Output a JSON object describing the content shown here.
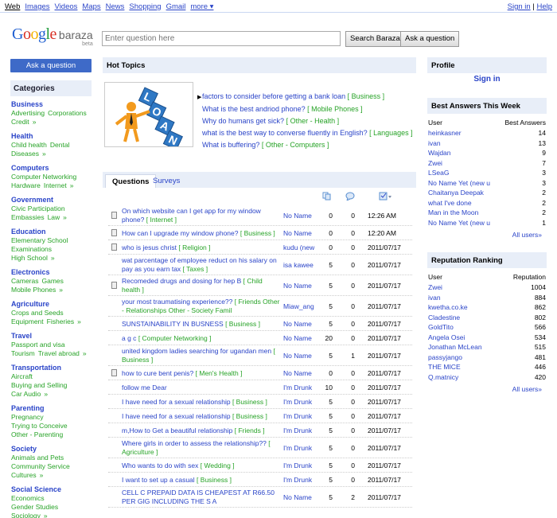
{
  "topnav": [
    "Web",
    "Images",
    "Videos",
    "Maps",
    "News",
    "Shopping",
    "Gmail",
    "more ▾"
  ],
  "topright": {
    "signin": "Sign in",
    "sep": " | ",
    "help": "Help"
  },
  "logo": {
    "google": "Google",
    "baraza": "baraza",
    "beta": "beta"
  },
  "search": {
    "placeholder": "Enter question here",
    "search_btn": "Search Baraza",
    "ask_btn": "Ask a question"
  },
  "sidebar": {
    "ask_label": "Ask a question",
    "categories_title": "Categories",
    "categories": [
      {
        "title": "Business",
        "lines": [
          [
            "Advertising",
            "Corporations"
          ],
          [
            "Credit",
            "»"
          ]
        ]
      },
      {
        "title": "Health",
        "lines": [
          [
            "Child health",
            "Dental"
          ],
          [
            "Diseases",
            "»"
          ]
        ]
      },
      {
        "title": "Computers",
        "lines": [
          [
            "Computer Networking"
          ],
          [
            "Hardware",
            "Internet",
            "»"
          ]
        ]
      },
      {
        "title": "Government",
        "lines": [
          [
            "Civic Participation"
          ],
          [
            "Embassies",
            "Law",
            "»"
          ]
        ]
      },
      {
        "title": "Education",
        "lines": [
          [
            "Elementary School"
          ],
          [
            "Examinations"
          ],
          [
            "High School",
            "»"
          ]
        ]
      },
      {
        "title": "Electronics",
        "lines": [
          [
            "Cameras",
            "Games"
          ],
          [
            "Mobile Phones",
            "»"
          ]
        ]
      },
      {
        "title": "Agriculture",
        "lines": [
          [
            "Crops and Seeds"
          ],
          [
            "Equipment",
            "Fisheries",
            "»"
          ]
        ]
      },
      {
        "title": "Travel",
        "lines": [
          [
            "Passport and visa"
          ],
          [
            "Tourism",
            "Travel abroad",
            "»"
          ]
        ]
      },
      {
        "title": "Transportation",
        "lines": [
          [
            "Aircraft"
          ],
          [
            "Buying and Selling"
          ],
          [
            "Car Audio",
            "»"
          ]
        ]
      },
      {
        "title": "Parenting",
        "lines": [
          [
            "Pregnancy"
          ],
          [
            "Trying to Conceive"
          ],
          [
            "Other - Parenting"
          ]
        ]
      },
      {
        "title": "Society",
        "lines": [
          [
            "Animals and Pets"
          ],
          [
            "Community Service"
          ],
          [
            "Cultures",
            "»"
          ]
        ]
      },
      {
        "title": "Social Science",
        "lines": [
          [
            "Economics"
          ],
          [
            "Gender Studies"
          ],
          [
            "Sociology",
            "»"
          ]
        ]
      }
    ]
  },
  "hot": {
    "title": "Hot Topics",
    "items": [
      {
        "q": "factors to consider before getting a bank loan",
        "tag": "[ Business ]"
      },
      {
        "q": "What is the best andriod phone?",
        "tag": "[ Mobile Phones ]"
      },
      {
        "q": "Why do humans get sick?",
        "tag": "[ Other - Health ]"
      },
      {
        "q": "what is the best way to converse fluently in English?",
        "tag": "[ Languages ]"
      },
      {
        "q": "What is buffering?",
        "tag": "[ Other - Computers ]"
      }
    ]
  },
  "tabs": {
    "questions": "Questions",
    "surveys": "Surveys"
  },
  "questions": [
    {
      "q": "On which website can I get app for my window phone?",
      "tag": "[ Internet ]",
      "user": "No Name",
      "a": "0",
      "c": "0",
      "date": "12:26 AM",
      "icon": true,
      "h": 26
    },
    {
      "q": "How can I upgrade my window phone?",
      "tag": "[ Business ]",
      "user": "No Name",
      "a": "0",
      "c": "0",
      "date": "12:20 AM",
      "icon": true,
      "h": 18
    },
    {
      "q": "who is jesus christ",
      "tag": "[ Religion ]",
      "user": "kudu (new",
      "a": "0",
      "c": "0",
      "date": "2011/07/17",
      "icon": true,
      "h": 18
    },
    {
      "q": "wat parcentage of employee reduct on his salary on pay as you earn tax",
      "tag": "[ Taxes ]",
      "user": "isa kawee",
      "a": "5",
      "c": "0",
      "date": "2011/07/17",
      "icon": false,
      "h": 26
    },
    {
      "q": "Recomeded drugs and dosing for hep B",
      "tag": "[ Child health ]",
      "user": "No Name",
      "a": "5",
      "c": "0",
      "date": "2011/07/17",
      "icon": true,
      "h": 26
    },
    {
      "q": "your most traumatising experience??",
      "tag": "[ Friends  Other - Relationships  Other - Society  Famil",
      "user": "Miaw_ang",
      "a": "5",
      "c": "0",
      "date": "2011/07/17",
      "icon": false,
      "h": 26
    },
    {
      "q": "SUNSTAINABILITY IN BUSNESS",
      "tag": "[ Business ]",
      "user": "No Name",
      "a": "5",
      "c": "0",
      "date": "2011/07/17",
      "icon": false,
      "h": 18
    },
    {
      "q": "a g c",
      "tag": "[ Computer Networking ]",
      "user": "No Name",
      "a": "20",
      "c": "0",
      "date": "2011/07/17",
      "icon": false,
      "h": 18
    },
    {
      "q": "united kingdom ladies searching for ugandan men",
      "tag": "[ Business ]",
      "user": "No Name",
      "a": "5",
      "c": "1",
      "date": "2011/07/17",
      "icon": false,
      "h": 26
    },
    {
      "q": "how to cure bent penis?",
      "tag": "[ Men's Health ]",
      "user": "No Name",
      "a": "0",
      "c": "0",
      "date": "2011/07/17",
      "icon": true,
      "h": 18
    },
    {
      "q": "follow me Dear",
      "tag": "",
      "user": "I'm Drunk",
      "a": "10",
      "c": "0",
      "date": "2011/07/17",
      "icon": false,
      "h": 18
    },
    {
      "q": "I have need for a sexual relationship",
      "tag": "[ Business ]",
      "user": "I'm Drunk",
      "a": "5",
      "c": "0",
      "date": "2011/07/17",
      "icon": false,
      "h": 18
    },
    {
      "q": "I have need for a sexual relationship",
      "tag": "[ Business ]",
      "user": "I'm Drunk",
      "a": "5",
      "c": "0",
      "date": "2011/07/17",
      "icon": false,
      "h": 18
    },
    {
      "q": "m,How to Get a beautiful relationship",
      "tag": "[ Friends ]",
      "user": "I'm Drunk",
      "a": "5",
      "c": "0",
      "date": "2011/07/17",
      "icon": false,
      "h": 18
    },
    {
      "q": "Where girls in order to assess the relationship??",
      "tag": "[ Agriculture ]",
      "user": "I'm Drunk",
      "a": "5",
      "c": "0",
      "date": "2011/07/17",
      "icon": false,
      "h": 26
    },
    {
      "q": "Who wants to do with sex",
      "tag": "[ Wedding ]",
      "user": "I'm Drunk",
      "a": "5",
      "c": "0",
      "date": "2011/07/17",
      "icon": false,
      "h": 18
    },
    {
      "q": "I want to set up a casual",
      "tag": "[ Business ]",
      "user": "I'm Drunk",
      "a": "5",
      "c": "0",
      "date": "2011/07/17",
      "icon": false,
      "h": 18
    },
    {
      "q": "CELL C PREPAID DATA IS CHEAPEST AT R66.50 PER GIG INCLUDING THE S A",
      "tag": "",
      "user": "No Name",
      "a": "5",
      "c": "2",
      "date": "2011/07/17",
      "icon": false,
      "h": 26
    }
  ],
  "profile": {
    "title": "Profile",
    "signin": "Sign in"
  },
  "best": {
    "title": "Best Answers This Week",
    "col_user": "User",
    "col_val": "Best Answers",
    "rows": [
      [
        "heinkasner",
        "14"
      ],
      [
        "ivan",
        "13"
      ],
      [
        "Wajdan",
        "9"
      ],
      [
        "Zwei",
        "7"
      ],
      [
        "LSeaG",
        "3"
      ],
      [
        "No Name Yet (new u",
        "3"
      ],
      [
        "Chaitanya Deepak",
        "2"
      ],
      [
        "what I've done",
        "2"
      ],
      [
        "Man in the Moon",
        "2"
      ],
      [
        "No Name Yet (new u",
        "1"
      ]
    ],
    "all": "All users»"
  },
  "rep": {
    "title": "Reputation Ranking",
    "col_user": "User",
    "col_val": "Reputation",
    "rows": [
      [
        "Zwei",
        "1004"
      ],
      [
        "ivan",
        "884"
      ],
      [
        "kwetha.co.ke",
        "862"
      ],
      [
        "Cladestine",
        "802"
      ],
      [
        "GoldTito",
        "566"
      ],
      [
        "Angela Osei",
        "534"
      ],
      [
        "Jonathan McLean",
        "515"
      ],
      [
        "passyjango",
        "481"
      ],
      [
        "THE MICE",
        "446"
      ],
      [
        "Q.matnicy",
        "420"
      ]
    ],
    "all": "All users»"
  },
  "colors": {
    "accent": "#3e6ac8",
    "link": "#2a44c8",
    "tag": "#27a327",
    "panel": "#e8eef8"
  }
}
